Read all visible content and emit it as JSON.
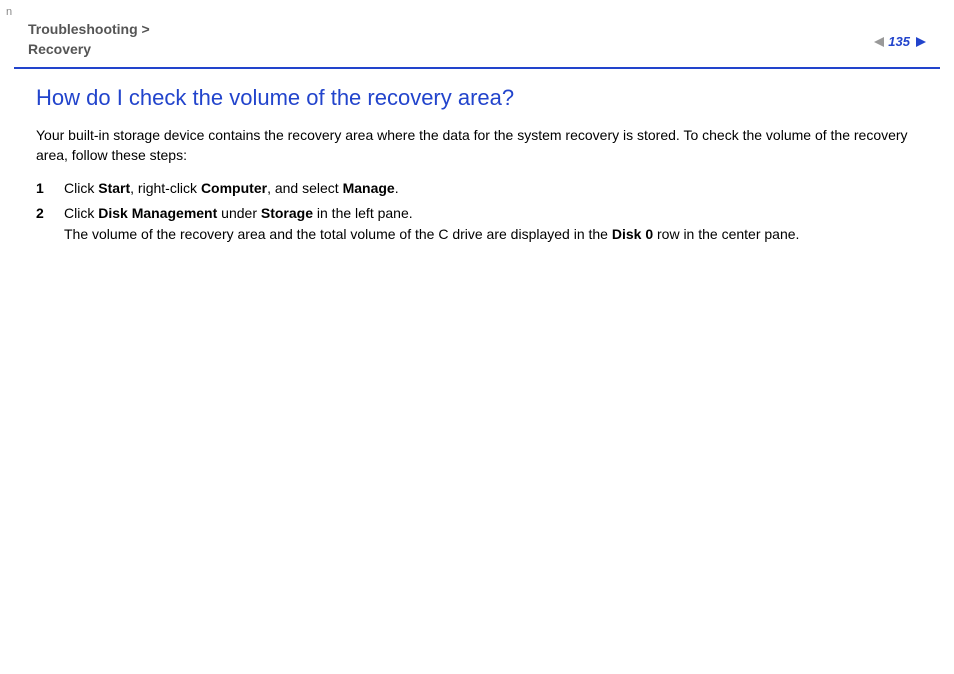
{
  "corner_marker": "n",
  "breadcrumb": {
    "part1": "Troubleshooting",
    "separator": " > ",
    "part2": "Recovery"
  },
  "page_number": "135",
  "heading": "How do I check the volume of the recovery area?",
  "intro": "Your built-in storage device contains the recovery area where the data for the system recovery is stored. To check the volume of the recovery area, follow these steps:",
  "steps": {
    "s1": {
      "t1": "Click ",
      "b1": "Start",
      "t2": ", right-click ",
      "b2": "Computer",
      "t3": ", and select ",
      "b3": "Manage",
      "t4": "."
    },
    "s2": {
      "t1": "Click ",
      "b1": "Disk Management",
      "t2": " under ",
      "b2": "Storage",
      "t3": " in the left pane.",
      "line2a": "The volume of the recovery area and the total volume of the C drive are displayed in the ",
      "b3": "Disk 0",
      "line2b": " row in the center pane."
    }
  }
}
